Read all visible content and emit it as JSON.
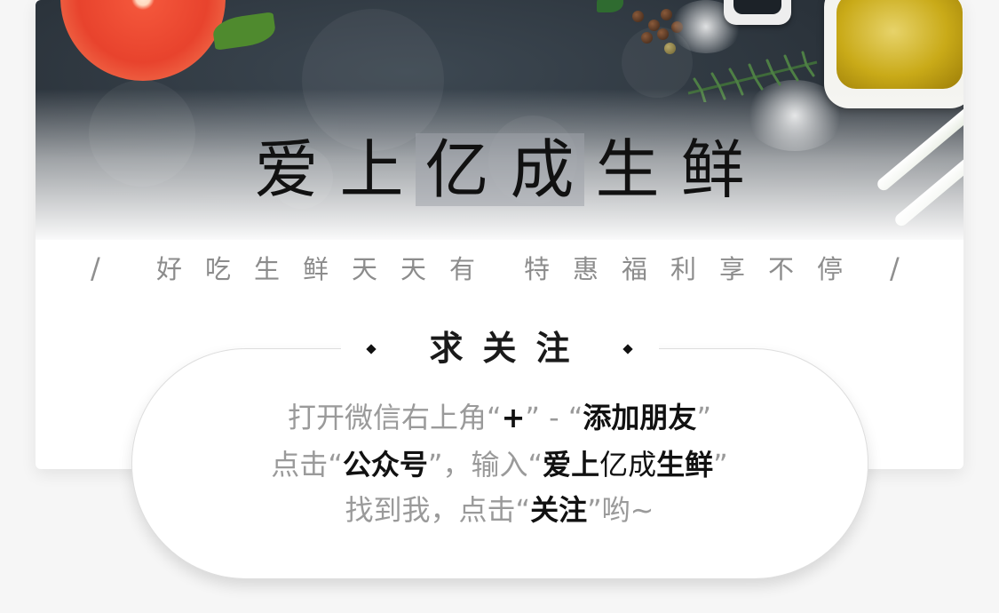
{
  "colors": {
    "background": "#f6f6f6",
    "card": "#ffffff",
    "hero_dark": "#2b333b",
    "title_text": "#111111",
    "slogan_text": "#8c8c8c",
    "highlight": "#9ea3a9"
  },
  "icons": [
    "grapefruit-image",
    "oil-bowl-image",
    "rosemary-image",
    "salt-image",
    "pepper-image",
    "scallion-image"
  ],
  "hero": {
    "title": "爱上亿成生鲜"
  },
  "slogan": {
    "left_mark": "/",
    "part1": "好吃生鲜天天有",
    "part2": "特惠福利享不停",
    "right_mark": "/"
  },
  "follow": {
    "heading": "求关注"
  },
  "instructions": {
    "line1": {
      "t1": "打开微信右上角",
      "q_open": "“",
      "plus": "+",
      "q_close": "”",
      "dash": " - ",
      "q_open2": "“",
      "add_friend": "添加朋友",
      "q_close2": "”"
    },
    "line2": {
      "t1": "点击",
      "q_open": "“",
      "official": "公众号",
      "q_close": "”",
      "t2": "，输入",
      "q_open2": "“",
      "name_a": "爱上",
      "name_b": "亿成",
      "name_c": "生鲜",
      "q_close2": "”"
    },
    "line3": {
      "t1": "找到我，点击",
      "q_open": "“",
      "follow": "关注",
      "q_close": "”",
      "t2": "哟~"
    }
  }
}
